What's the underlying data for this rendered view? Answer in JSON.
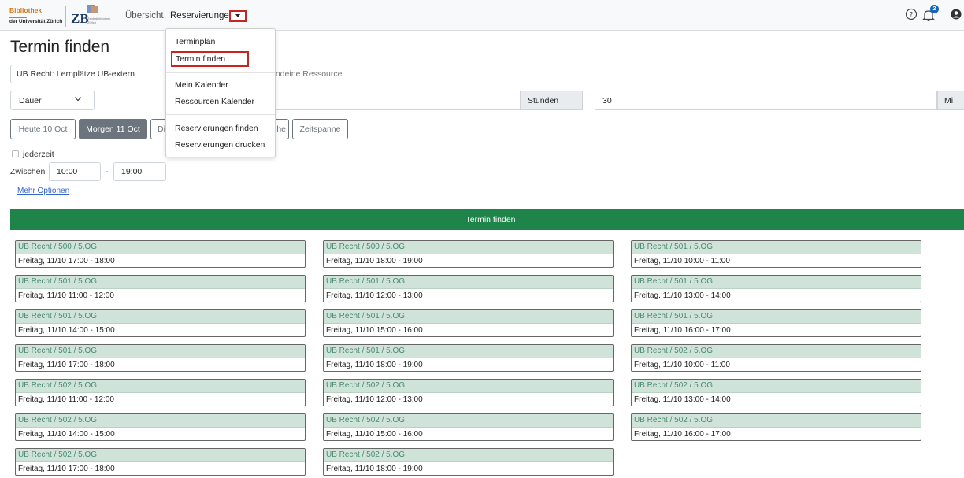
{
  "navbar": {
    "logo_ub_line1": "Bibliothek",
    "logo_ub_line2": "der Universität Zürich",
    "logo_zb_text": "ZB",
    "logo_zb_sub": "Zentralbibliothek Zürich",
    "links": [
      "Übersicht",
      "Reservierungen"
    ],
    "notification_count": "2",
    "icons": [
      "help-circle-icon",
      "bell-icon",
      "user-icon",
      "caret-down-icon"
    ]
  },
  "dropdown": {
    "items": [
      "Terminplan",
      "Termin finden",
      "Mein Kalender",
      "Ressourcen Kalender",
      "Reservierungen finden",
      "Reservierungen drucken"
    ],
    "highlighted": "Termin finden"
  },
  "page": {
    "title": "Termin finden",
    "resource_value": "UB Recht: Lernplätze UB-extern",
    "resource_placeholder_visible": "endeine Ressource",
    "duration_mode": "Dauer",
    "hours_label": "Stunden",
    "minutes_value": "30",
    "minutes_label": "Mi",
    "day_buttons": [
      "Heute 10 Oct",
      "Morgen 11 Oct",
      "Di",
      "he",
      "Zeitspanne"
    ],
    "active_day": "Morgen 11 Oct",
    "anytime_label": "jederzeit",
    "between_label": "Zwischen",
    "time_from": "10:00",
    "time_to": "19:00",
    "dash": "-",
    "more_options": "Mehr Optionen",
    "find_button": "Termin finden"
  },
  "colors": {
    "primary_green": "#1e8449",
    "card_header_bg": "#cfe3d9",
    "card_header_text": "#4a8a73",
    "highlight_red": "#cc2222",
    "link_blue": "#3366cc"
  },
  "results": [
    {
      "resource": "UB Recht / 500 / 5.OG",
      "time": "Freitag, 11/10 17:00 - 18:00"
    },
    {
      "resource": "UB Recht / 500 / 5.OG",
      "time": "Freitag, 11/10 18:00 - 19:00"
    },
    {
      "resource": "UB Recht / 501 / 5.OG",
      "time": "Freitag, 11/10 10:00 - 11:00"
    },
    {
      "resource": "UB Recht / 501 / 5.OG",
      "time": "Freitag, 11/10 11:00 - 12:00"
    },
    {
      "resource": "UB Recht / 501 / 5.OG",
      "time": "Freitag, 11/10 12:00 - 13:00"
    },
    {
      "resource": "UB Recht / 501 / 5.OG",
      "time": "Freitag, 11/10 13:00 - 14:00"
    },
    {
      "resource": "UB Recht / 501 / 5.OG",
      "time": "Freitag, 11/10 14:00 - 15:00"
    },
    {
      "resource": "UB Recht / 501 / 5.OG",
      "time": "Freitag, 11/10 15:00 - 16:00"
    },
    {
      "resource": "UB Recht / 501 / 5.OG",
      "time": "Freitag, 11/10 16:00 - 17:00"
    },
    {
      "resource": "UB Recht / 501 / 5.OG",
      "time": "Freitag, 11/10 17:00 - 18:00"
    },
    {
      "resource": "UB Recht / 501 / 5.OG",
      "time": "Freitag, 11/10 18:00 - 19:00"
    },
    {
      "resource": "UB Recht / 502 / 5.OG",
      "time": "Freitag, 11/10 10:00 - 11:00"
    },
    {
      "resource": "UB Recht / 502 / 5.OG",
      "time": "Freitag, 11/10 11:00 - 12:00"
    },
    {
      "resource": "UB Recht / 502 / 5.OG",
      "time": "Freitag, 11/10 12:00 - 13:00"
    },
    {
      "resource": "UB Recht / 502 / 5.OG",
      "time": "Freitag, 11/10 13:00 - 14:00"
    },
    {
      "resource": "UB Recht / 502 / 5.OG",
      "time": "Freitag, 11/10 14:00 - 15:00"
    },
    {
      "resource": "UB Recht / 502 / 5.OG",
      "time": "Freitag, 11/10 15:00 - 16:00"
    },
    {
      "resource": "UB Recht / 502 / 5.OG",
      "time": "Freitag, 11/10 16:00 - 17:00"
    },
    {
      "resource": "UB Recht / 502 / 5.OG",
      "time": "Freitag, 11/10 17:00 - 18:00"
    },
    {
      "resource": "UB Recht / 502 / 5.OG",
      "time": "Freitag, 11/10 18:00 - 19:00"
    }
  ]
}
